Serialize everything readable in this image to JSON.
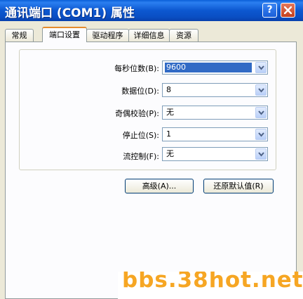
{
  "window": {
    "title": "通讯端口 (COM1) 属性",
    "help_label": "?"
  },
  "tabs": [
    {
      "label": "常规",
      "active": false
    },
    {
      "label": "端口设置",
      "active": true
    },
    {
      "label": "驱动程序",
      "active": false
    },
    {
      "label": "详细信息",
      "active": false
    },
    {
      "label": "资源",
      "active": false
    }
  ],
  "settings": [
    {
      "label": "每秒位数(B):",
      "value": "9600",
      "selected": true
    },
    {
      "label": "数据位(D):",
      "value": "8"
    },
    {
      "label": "奇偶校验(P):",
      "value": "无"
    },
    {
      "label": "停止位(S):",
      "value": "1"
    },
    {
      "label": "流控制(F):",
      "value": "无"
    }
  ],
  "buttons": {
    "advanced": "高级(A)...",
    "restore_defaults": "还原默认值(R)"
  },
  "watermark": "bbs.38hot.net",
  "icons": {
    "close": "close-icon",
    "dropdown": "chevron-down-icon"
  },
  "colors": {
    "titlebar": "#0a53d0",
    "selection": "#316ac5",
    "watermark": "#f6a623"
  }
}
